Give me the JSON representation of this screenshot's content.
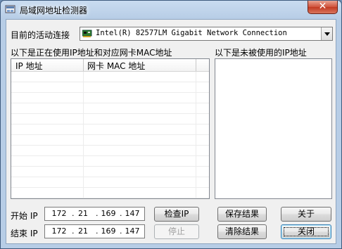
{
  "window": {
    "title": "局域网地址检测器"
  },
  "adapter": {
    "label": "目前的活动连接",
    "value": "Intel(R) 82577LM Gigabit Network Connection"
  },
  "used": {
    "label": "以下是正在使用IP地址和对应网卡MAC地址",
    "columns": [
      "IP 地址",
      "网卡 MAC 地址"
    ],
    "rows": []
  },
  "unused": {
    "label": "以下是未被使用的IP地址",
    "items": []
  },
  "range": {
    "start_label": "开始 IP",
    "end_label": "结束 IP",
    "start": [
      "172",
      "21",
      "169",
      "147"
    ],
    "end": [
      "172",
      "21",
      "169",
      "147"
    ]
  },
  "buttons": {
    "check": "检查IP",
    "stop": "停止",
    "save": "保存结果",
    "clear": "清除结果",
    "about": "关于",
    "close": "关闭"
  },
  "icons": {
    "app": "window-app-icon",
    "nic": "network-card-icon",
    "close": "close-x-icon"
  }
}
